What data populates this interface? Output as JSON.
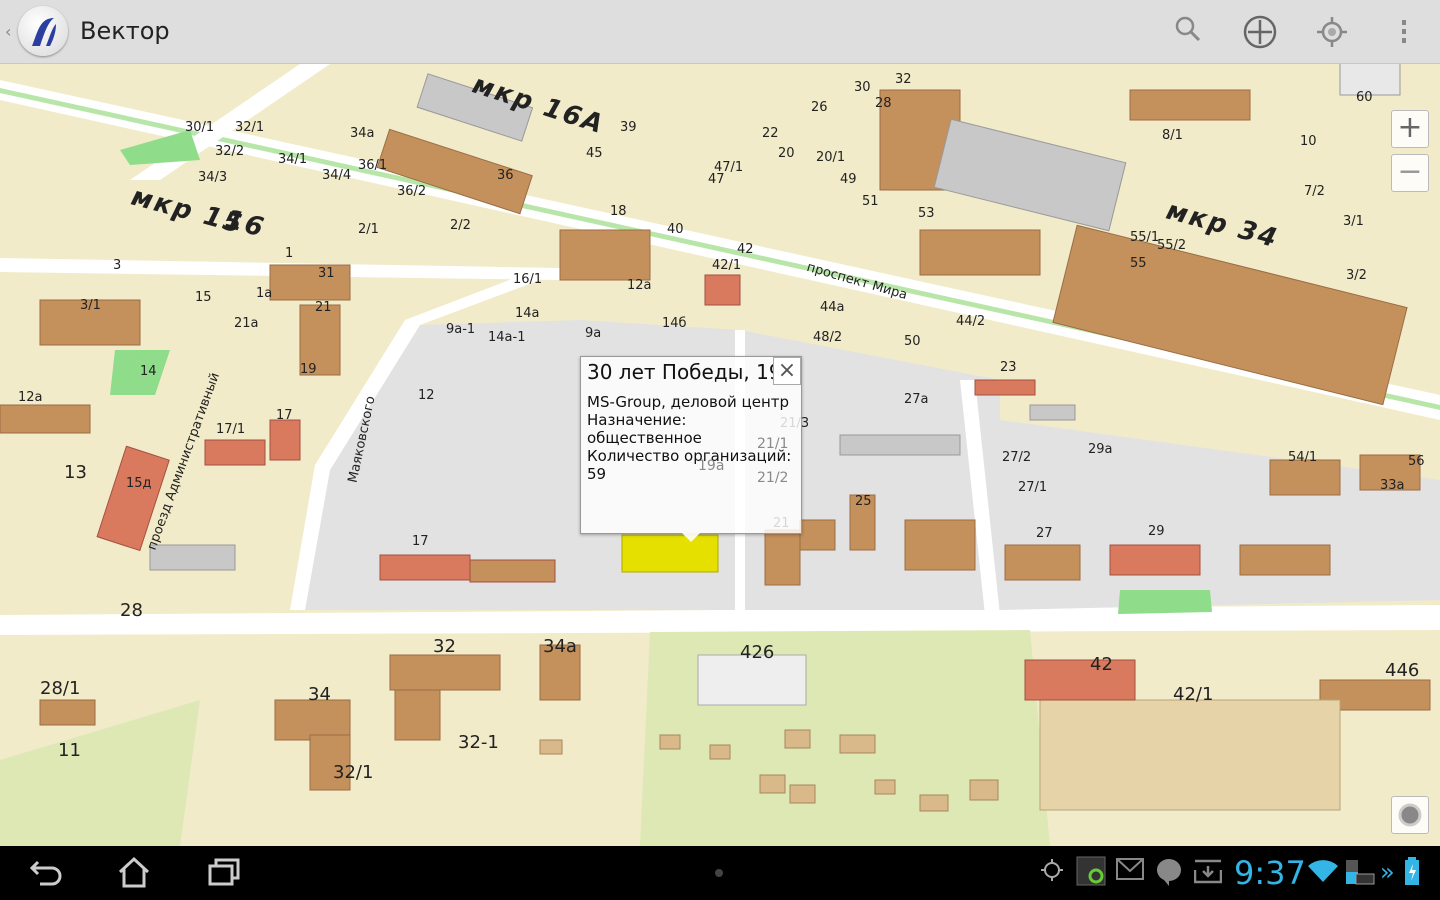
{
  "app": {
    "title": "Вектор"
  },
  "actionbar": {
    "icons": [
      "search-icon",
      "move-icon",
      "locate-icon",
      "overflow-menu-icon"
    ]
  },
  "map": {
    "districts": [
      "мкр 15",
      "16",
      "мкр 16А",
      "мкр 34"
    ],
    "streets": [
      "проспект Мира",
      "Маяковского",
      "проезд Административный"
    ],
    "labels": [
      "30/1",
      "32/1",
      "32/2",
      "34/1",
      "34/3",
      "34/4",
      "34а",
      "36/1",
      "36/2",
      "36",
      "2/1",
      "2/2",
      "3",
      "1",
      "31",
      "15",
      "1а",
      "21",
      "21а",
      "3/1",
      "14",
      "12а",
      "13",
      "15д",
      "19",
      "17",
      "17/1",
      "12",
      "9а-1",
      "9а",
      "14а",
      "14а-1",
      "16/1",
      "14б",
      "12а",
      "18",
      "40",
      "42",
      "42/1",
      "44а",
      "48/2",
      "50",
      "44/2",
      "23",
      "27а",
      "27/2",
      "27/1",
      "29а",
      "27",
      "29",
      "54/1",
      "56",
      "33а",
      "25",
      "17",
      "28",
      "28/1",
      "11",
      "34",
      "32",
      "34а",
      "32-1",
      "32/1",
      "426",
      "42",
      "42/1",
      "446",
      "55/1",
      "55/2",
      "55",
      "3/2",
      "3/1",
      "53",
      "51",
      "49",
      "45",
      "39",
      "47/1",
      "47",
      "20/1",
      "20",
      "22",
      "26",
      "28",
      "30",
      "32",
      "60",
      "10",
      "8/1",
      "7/2",
      "21/3",
      "21/1",
      "21/2",
      "21",
      "19а"
    ],
    "zoom_in": "+",
    "zoom_out": "−"
  },
  "popup": {
    "title": "30 лет Победы, 19",
    "name": "MS-Group, деловой центр",
    "purpose_label": "Назначение:",
    "purpose_value": "общественное",
    "count_label": "Количество организаций:",
    "count_value": "59",
    "close": "×"
  },
  "statusbar": {
    "time": "9:37"
  }
}
